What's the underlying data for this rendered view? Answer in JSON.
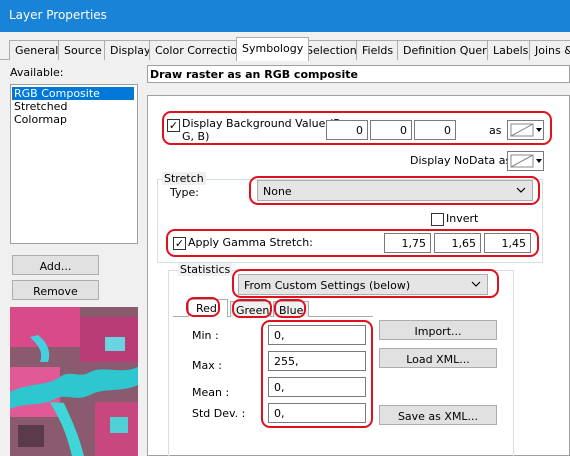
{
  "window": {
    "title": "Layer Properties"
  },
  "tabs": [
    {
      "label": "General",
      "active": false
    },
    {
      "label": "Source",
      "active": false
    },
    {
      "label": "Display",
      "active": false
    },
    {
      "label": "Color Correction",
      "active": false
    },
    {
      "label": "Symbology",
      "active": true
    },
    {
      "label": "Selection",
      "active": false
    },
    {
      "label": "Fields",
      "active": false
    },
    {
      "label": "Definition Query",
      "active": false
    },
    {
      "label": "Labels",
      "active": false
    },
    {
      "label": "Joins &",
      "active": false
    }
  ],
  "left_panel": {
    "available_label": "Available:",
    "items": [
      {
        "label": "RGB Composite",
        "selected": true
      },
      {
        "label": "Stretched",
        "selected": false
      },
      {
        "label": "Colormap",
        "selected": false
      }
    ],
    "add_button": "Add...",
    "remove_button": "Remove"
  },
  "header": {
    "description": "Draw raster as an RGB composite"
  },
  "background": {
    "checked": true,
    "label_line1": "Display Background Value:(R,",
    "label_line2": "G, B)",
    "r": "0",
    "g": "0",
    "b": "0",
    "as_label": "as"
  },
  "nodata": {
    "label": "Display NoData as"
  },
  "stretch": {
    "group_label": "Stretch",
    "type_label": "Type:",
    "type_value": "None",
    "invert_label": "Invert",
    "invert_checked": false,
    "gamma_checked": true,
    "gamma_label": "Apply Gamma Stretch:",
    "gamma_r": "1,75",
    "gamma_g": "1,65",
    "gamma_b": "1,45"
  },
  "statistics": {
    "group_label": "Statistics",
    "source_value": "From Custom Settings (below)",
    "band_tabs": [
      {
        "label": "Red",
        "active": true
      },
      {
        "label": "Green",
        "active": false
      },
      {
        "label": "Blue",
        "active": false
      }
    ],
    "fields": {
      "min_label": "Min :",
      "min_value": "0,",
      "max_label": "Max :",
      "max_value": "255,",
      "mean_label": "Mean :",
      "mean_value": "0,",
      "std_label": "Std Dev. :",
      "std_value": "0,"
    },
    "import_button": "Import...",
    "load_xml_button": "Load XML...",
    "save_xml_button": "Save as XML..."
  },
  "colors": {
    "titlebar": "#1883d7",
    "selection": "#0078d7",
    "annotation_red": "#e0101e"
  }
}
